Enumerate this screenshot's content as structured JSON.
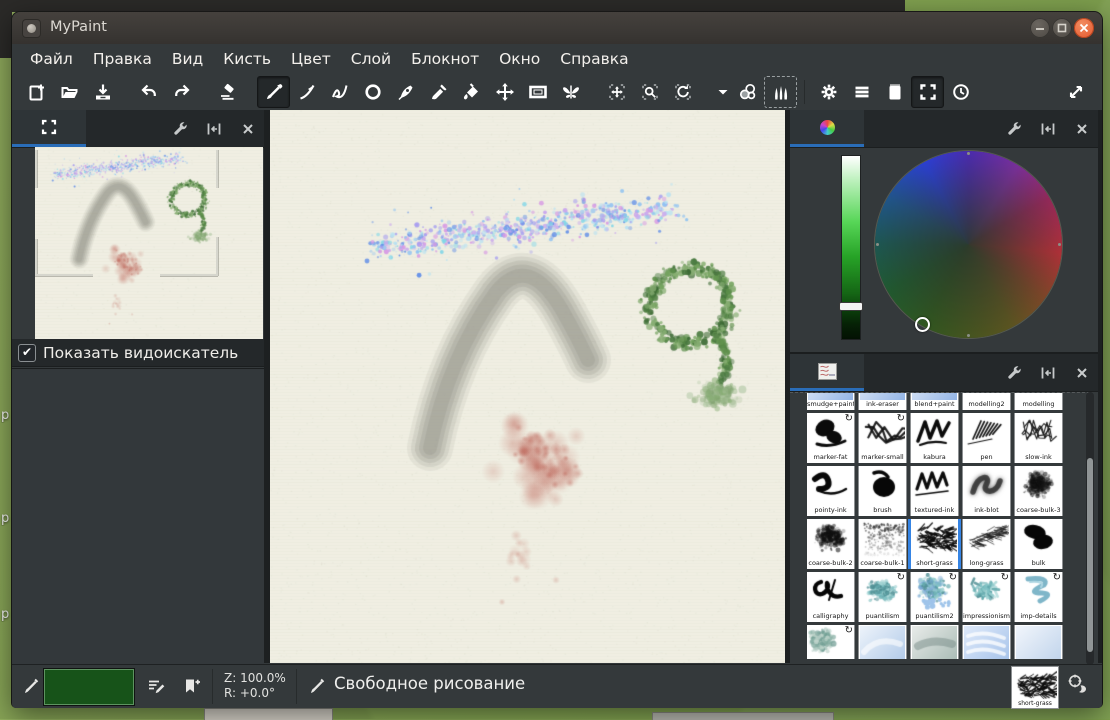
{
  "window": {
    "title": "MyPaint",
    "controls": [
      {
        "id": "minimize"
      },
      {
        "id": "maximize"
      },
      {
        "id": "close"
      }
    ]
  },
  "menubar": {
    "items": [
      {
        "id": "file",
        "label": "Файл"
      },
      {
        "id": "edit",
        "label": "Правка"
      },
      {
        "id": "view",
        "label": "Вид"
      },
      {
        "id": "brush",
        "label": "Кисть"
      },
      {
        "id": "color",
        "label": "Цвет"
      },
      {
        "id": "layer",
        "label": "Слой"
      },
      {
        "id": "scratchpad",
        "label": "Блокнот"
      },
      {
        "id": "window",
        "label": "Окно"
      },
      {
        "id": "help",
        "label": "Справка"
      }
    ]
  },
  "toolbar": {
    "items": [
      {
        "id": "new-file"
      },
      {
        "id": "open-file"
      },
      {
        "id": "save-file"
      },
      {
        "id": "gap"
      },
      {
        "id": "undo"
      },
      {
        "id": "redo"
      },
      {
        "id": "gap"
      },
      {
        "id": "eraser"
      },
      {
        "id": "gap"
      },
      {
        "id": "freehand",
        "active": true
      },
      {
        "id": "lines-curves"
      },
      {
        "id": "connected-lines"
      },
      {
        "id": "ellipse"
      },
      {
        "id": "inking"
      },
      {
        "id": "pick-color"
      },
      {
        "id": "flood-fill"
      },
      {
        "id": "move-layer"
      },
      {
        "id": "frame-edit"
      },
      {
        "id": "symmetry"
      },
      {
        "id": "gap"
      },
      {
        "id": "pan-view"
      },
      {
        "id": "zoom-view"
      },
      {
        "id": "rotate-view"
      },
      {
        "id": "gap"
      },
      {
        "id": "dropdown"
      },
      {
        "id": "color-window"
      },
      {
        "id": "brush-window",
        "dashed": true
      },
      {
        "id": "sep"
      },
      {
        "id": "preferences"
      },
      {
        "id": "layers-window"
      },
      {
        "id": "scratchpad-window"
      },
      {
        "id": "fullscreen",
        "active": true
      },
      {
        "id": "history"
      },
      {
        "id": "push"
      },
      {
        "id": "expand-view"
      }
    ]
  },
  "panels": {
    "preview": {
      "checkbox_label": "Показать видоискатель",
      "checkbox_checked": "✔"
    },
    "brushes": {
      "rows": [
        [
          {
            "label": "smudge+paint",
            "style": "bluegrad"
          },
          {
            "label": "ink-eraser",
            "style": "bluegrad"
          },
          {
            "label": "blend+paint",
            "style": "bluegrad"
          },
          {
            "label": "modelling2",
            "style": "faint"
          },
          {
            "label": "modelling",
            "style": "faint"
          }
        ],
        [
          {
            "label": "marker-fat",
            "style": "fatblob",
            "arrow": true
          },
          {
            "label": "marker-small",
            "style": "scribble",
            "arrow": true
          },
          {
            "label": "kabura",
            "style": "zigzag"
          },
          {
            "label": "pen",
            "style": "hatch"
          },
          {
            "label": "slow-ink",
            "style": "scratchy"
          }
        ],
        [
          {
            "label": "pointy-ink",
            "style": "pointy"
          },
          {
            "label": "brush",
            "style": "bigblob"
          },
          {
            "label": "textured-ink",
            "style": "zigzag2"
          },
          {
            "label": "ink-blot",
            "style": "softink"
          },
          {
            "label": "coarse-bulk-3",
            "style": "noise"
          }
        ],
        [
          {
            "label": "coarse-bulk-2",
            "style": "noise2"
          },
          {
            "label": "coarse-bulk-1",
            "style": "specks"
          },
          {
            "label": "short-grass",
            "style": "grass",
            "selected": true
          },
          {
            "label": "long-grass",
            "style": "grass2"
          },
          {
            "label": "bulk",
            "style": "bulk"
          }
        ],
        [
          {
            "label": "calligraphy",
            "style": "calligraphy"
          },
          {
            "label": "puantilism",
            "style": "tealspecks",
            "arrow": true
          },
          {
            "label": "puantilism2",
            "style": "tealspecks2",
            "arrow": true
          },
          {
            "label": "impressionism",
            "style": "impression",
            "arrow": true
          },
          {
            "label": "imp-details",
            "style": "tealstroke",
            "arrow": true
          }
        ],
        [
          {
            "label": "",
            "style": "softteal",
            "arrow": true
          },
          {
            "label": "",
            "style": "softblue"
          },
          {
            "label": "",
            "style": "graywash"
          },
          {
            "label": "",
            "style": "bluewaves"
          },
          {
            "label": "",
            "style": "softblue2"
          }
        ]
      ]
    }
  },
  "statusbar": {
    "zoom": "Z: 100.0%",
    "rotation": "R: +0.0°",
    "mode": "Свободное рисование",
    "current_brush": "short-grass",
    "swatch_color": "#175319"
  },
  "desktop": {
    "partial_labels": [
      "p",
      "p",
      "p"
    ]
  },
  "colors": {
    "accent_tab": "#2a6db8",
    "brush_selected_border": "#3584e4",
    "close_button": "#e4552a"
  }
}
